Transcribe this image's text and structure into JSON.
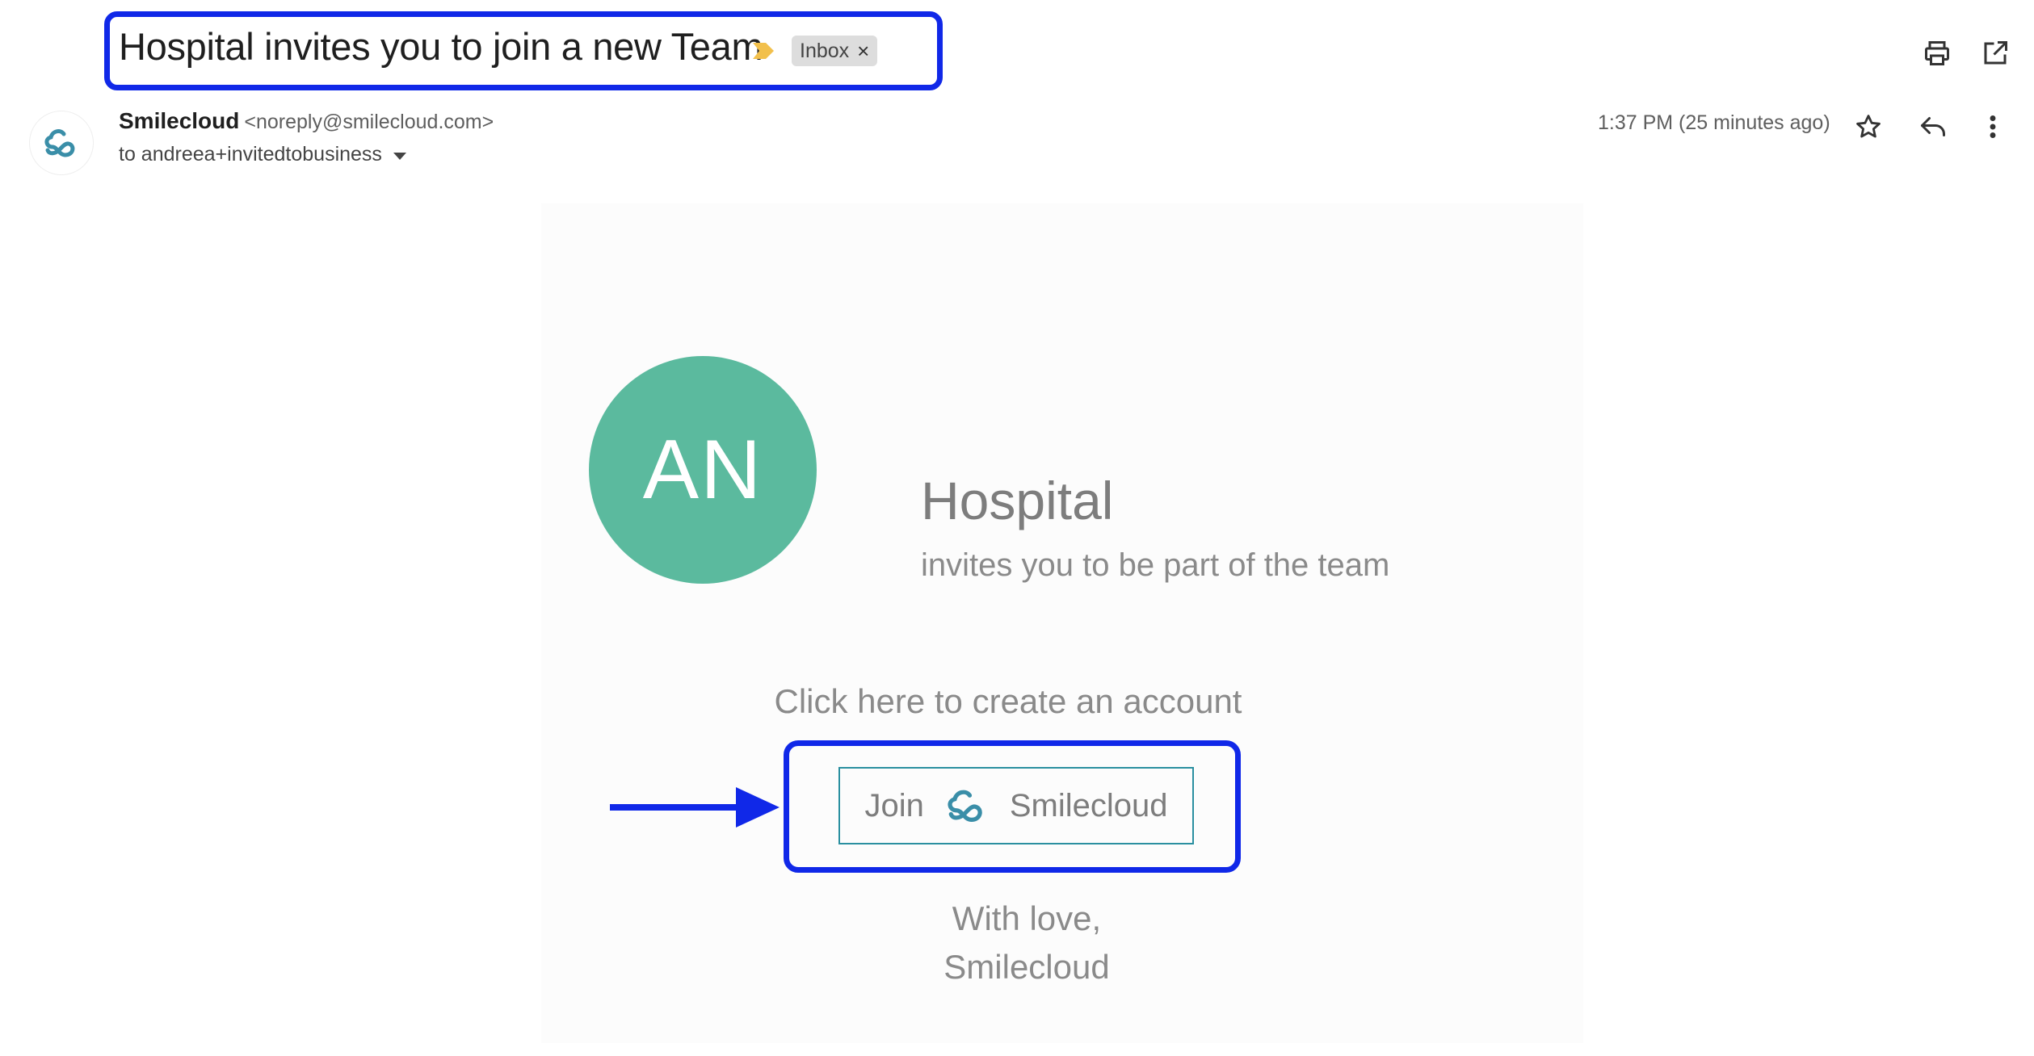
{
  "header": {
    "subject": "Hospital invites you to join a new Team",
    "label_chip": "Inbox",
    "label_remove": "×",
    "importance_color": "#f2c04c"
  },
  "toolbar": {
    "print_icon": "printer-icon",
    "open_icon": "open-in-new-window-icon"
  },
  "sender": {
    "name": "Smilecloud",
    "email": "<noreply@smilecloud.com>",
    "to": "to andreea+invitedtobusiness",
    "time": "1:37 PM (25 minutes ago)",
    "actions": [
      "star-icon",
      "reply-icon",
      "more-vert-icon"
    ]
  },
  "email": {
    "avatar_initials": "AN",
    "avatar_color": "#5bba9e",
    "team_name": "Hospital",
    "team_subtitle": "invites you to be part of the team",
    "cta_text": "Click here to create an account",
    "join_left": "Join",
    "join_right": "Smilecloud",
    "sign_line1": "With love,",
    "sign_line2": "Smilecloud"
  },
  "annotation": {
    "highlight_color": "#1028e8"
  }
}
